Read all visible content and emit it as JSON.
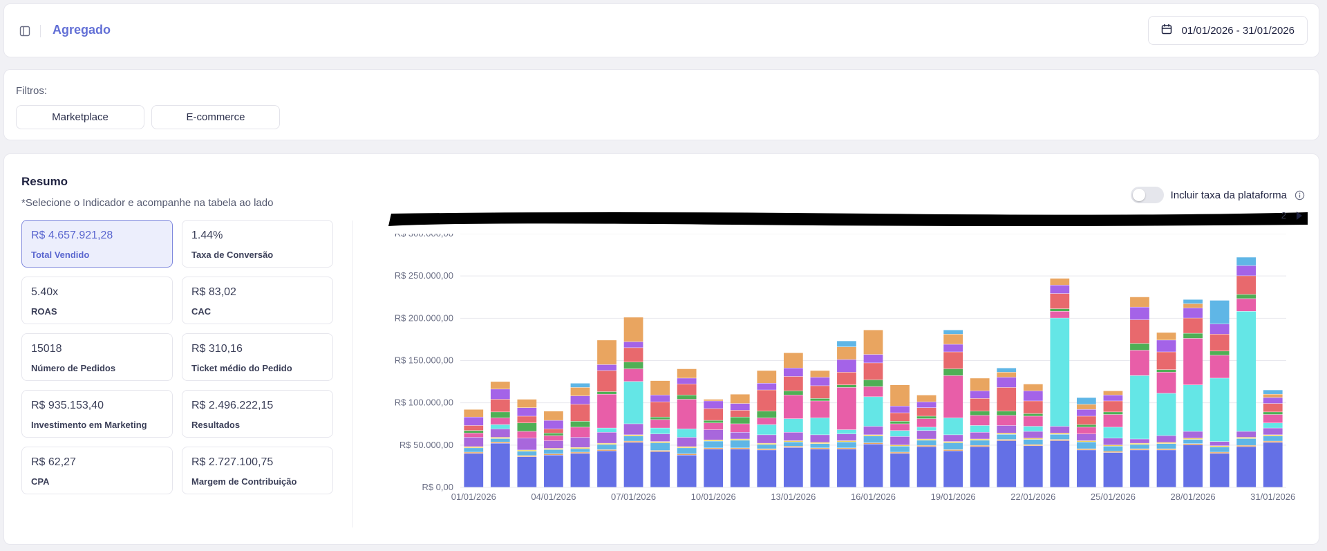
{
  "header": {
    "title": "Agregado",
    "date_range": "01/01/2026 - 31/01/2026"
  },
  "filters": {
    "label": "Filtros:",
    "options": [
      "Marketplace",
      "E-commerce"
    ]
  },
  "summary": {
    "title": "Resumo",
    "subtitle": "*Selecione o Indicador e acompanhe na tabela ao lado",
    "toggle_label": "Incluir taxa da plataforma",
    "toggle_on": false,
    "legend_page": "2",
    "kpis": [
      {
        "value": "R$ 4.657.921,28",
        "label": "Total Vendido",
        "active": true
      },
      {
        "value": "1.44%",
        "label": "Taxa de Conversão"
      },
      {
        "value": "5.40x",
        "label": "ROAS"
      },
      {
        "value": "R$ 83,02",
        "label": "CAC"
      },
      {
        "value": "15018",
        "label": "Número de Pedidos"
      },
      {
        "value": "R$ 310,16",
        "label": "Ticket médio do Pedido"
      },
      {
        "value": "R$ 935.153,40",
        "label": "Investimento em Marketing"
      },
      {
        "value": "R$ 2.496.222,15",
        "label": "Resultados"
      },
      {
        "value": "R$ 62,27",
        "label": "CPA"
      },
      {
        "value": "R$ 2.727.100,75",
        "label": "Margem de Contribuição"
      }
    ]
  },
  "chart_data": {
    "type": "bar",
    "stacked": true,
    "x": [
      "01/01/2026",
      "02/01/2026",
      "03/01/2026",
      "04/01/2026",
      "05/01/2026",
      "06/01/2026",
      "07/01/2026",
      "08/01/2026",
      "09/01/2026",
      "10/01/2026",
      "11/01/2026",
      "12/01/2026",
      "13/01/2026",
      "14/01/2026",
      "15/01/2026",
      "16/01/2026",
      "17/01/2026",
      "18/01/2026",
      "19/01/2026",
      "20/01/2026",
      "21/01/2026",
      "22/01/2026",
      "23/01/2026",
      "24/01/2026",
      "25/01/2026",
      "26/01/2026",
      "27/01/2026",
      "28/01/2026",
      "29/01/2026",
      "30/01/2026",
      "31/01/2026"
    ],
    "x_tick_labels": [
      "01/01/2026",
      "04/01/2026",
      "07/01/2026",
      "10/01/2026",
      "13/01/2026",
      "16/01/2026",
      "19/01/2026",
      "22/01/2026",
      "25/01/2026",
      "28/01/2026",
      "31/01/2026"
    ],
    "y_tick_labels": [
      "R$ 0,00",
      "R$ 50.000,00",
      "R$ 100.000,00",
      "R$ 150.000,00",
      "R$ 200.000,00",
      "R$ 250.000,00",
      "R$ 300.000,00"
    ],
    "ylim": [
      0,
      300000
    ],
    "grid": true,
    "legend": "redacted",
    "series": [
      {
        "color": "#6470e6",
        "values": [
          40000,
          52000,
          36000,
          38000,
          40000,
          43000,
          53000,
          42000,
          38000,
          45000,
          45000,
          44000,
          47000,
          45000,
          45000,
          51000,
          40000,
          48000,
          43000,
          48000,
          55000,
          49000,
          55000,
          44000,
          41000,
          44000,
          44000,
          50000,
          40000,
          48000,
          53000
        ]
      },
      {
        "color": "#e9a560",
        "values": [
          1500,
          1500,
          1500,
          1500,
          1500,
          1500,
          1500,
          1500,
          1500,
          1500,
          1500,
          1500,
          1500,
          1500,
          1500,
          1500,
          1500,
          1500,
          1500,
          1500,
          1500,
          1500,
          1500,
          1500,
          1500,
          1500,
          1500,
          1500,
          1500,
          1500,
          1500
        ]
      },
      {
        "color": "#5fb6e6",
        "values": [
          5000,
          4000,
          5000,
          5000,
          4000,
          6000,
          6000,
          9000,
          7000,
          8000,
          9000,
          5000,
          5000,
          5000,
          7000,
          8000,
          7000,
          6000,
          8000,
          6000,
          6000,
          6000,
          6000,
          8000,
          6000,
          5000,
          6000,
          5000,
          6000,
          8000,
          6000
        ]
      },
      {
        "color": "#f3d25b",
        "values": [
          1500,
          1500,
          1500,
          1500,
          1500,
          1500,
          1500,
          1500,
          1500,
          1500,
          1500,
          1500,
          1500,
          1500,
          1500,
          1500,
          1500,
          1500,
          1500,
          1500,
          1500,
          1500,
          1500,
          1500,
          1500,
          1500,
          1500,
          1500,
          1500,
          1500,
          1500
        ]
      },
      {
        "color": "#a867dc",
        "values": [
          11000,
          10000,
          14000,
          9000,
          12000,
          13000,
          13000,
          9000,
          11000,
          12000,
          8000,
          10000,
          10000,
          9000,
          8000,
          10000,
          10000,
          10000,
          8000,
          8000,
          9000,
          8000,
          8000,
          8000,
          8000,
          5000,
          8000,
          8000,
          5000,
          7000,
          8000
        ]
      },
      {
        "color": "#64e6e6",
        "values": [
          0,
          5000,
          0,
          0,
          0,
          5000,
          50000,
          7000,
          10000,
          0,
          0,
          12000,
          16000,
          20000,
          5000,
          35000,
          7000,
          4000,
          20000,
          8000,
          0,
          6000,
          128000,
          0,
          13000,
          75000,
          50000,
          55000,
          75000,
          142000,
          6000
        ]
      },
      {
        "color": "#e85ea8",
        "values": [
          5000,
          8000,
          8000,
          6000,
          12000,
          40000,
          15000,
          10000,
          35000,
          8000,
          10000,
          8000,
          28000,
          20000,
          50000,
          12000,
          8000,
          10000,
          50000,
          12000,
          12000,
          12000,
          8000,
          8000,
          15000,
          30000,
          25000,
          55000,
          27000,
          15000,
          10000
        ]
      },
      {
        "color": "#4faf55",
        "values": [
          3000,
          7000,
          10000,
          3000,
          7000,
          3000,
          8000,
          3000,
          5000,
          3000,
          8000,
          8000,
          5000,
          3000,
          3000,
          8000,
          3000,
          3000,
          8000,
          5000,
          5000,
          3000,
          3000,
          3000,
          3000,
          8000,
          3000,
          6000,
          5000,
          5000,
          3000
        ]
      },
      {
        "color": "#e8696d",
        "values": [
          6000,
          15000,
          8000,
          5000,
          20000,
          25000,
          17000,
          18000,
          13000,
          14000,
          8000,
          25000,
          17000,
          15000,
          15000,
          20000,
          10000,
          10000,
          20000,
          15000,
          28000,
          15000,
          18000,
          10000,
          13000,
          28000,
          21000,
          18000,
          20000,
          22000,
          10000
        ]
      },
      {
        "color": "#a463e8",
        "values": [
          10000,
          12000,
          10000,
          10000,
          10000,
          7000,
          7000,
          8000,
          7000,
          9000,
          8000,
          8000,
          10000,
          10000,
          15000,
          10000,
          8000,
          7000,
          9000,
          9000,
          12000,
          12000,
          10000,
          8000,
          7000,
          15000,
          14000,
          12000,
          12000,
          12000,
          7000
        ]
      },
      {
        "color": "#e9a560",
        "values": [
          9000,
          9000,
          10000,
          11000,
          10000,
          29000,
          29000,
          17000,
          11000,
          2000,
          11000,
          15000,
          18000,
          8000,
          15000,
          29000,
          25000,
          8000,
          12000,
          15000,
          6000,
          8000,
          8000,
          6000,
          5000,
          12000,
          9000,
          5000,
          0,
          0,
          4000
        ]
      },
      {
        "color": "#5fb6e6",
        "values": [
          0,
          0,
          0,
          0,
          5000,
          0,
          0,
          0,
          0,
          0,
          0,
          0,
          0,
          0,
          7000,
          0,
          0,
          0,
          5000,
          0,
          5000,
          0,
          0,
          8000,
          0,
          0,
          0,
          5000,
          28000,
          10000,
          5000
        ]
      }
    ]
  }
}
